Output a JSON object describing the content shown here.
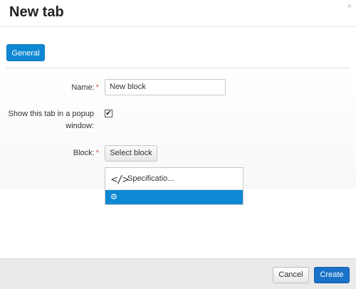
{
  "dialog": {
    "title": "New tab",
    "close_glyph": "×"
  },
  "tabs": [
    {
      "label": "General",
      "active": true
    }
  ],
  "form": {
    "name_label": "Name:",
    "required_mark": "*",
    "name_value": "New block",
    "popup_label_line1": "Show this tab in a popup",
    "popup_label_line2": "window:",
    "popup_checked": true,
    "check_glyph": "✔",
    "block_label": "Block:",
    "select_block_label": "Select block",
    "block_items": [
      {
        "icon": "code-icon",
        "glyph": "</>",
        "label": "Specificatio..."
      }
    ],
    "selected_icon": "gear-icon",
    "gear_glyph": "⚙"
  },
  "footer": {
    "cancel_label": "Cancel",
    "create_label": "Create"
  },
  "colors": {
    "accent": "#0e88d3",
    "create_button": "#1a73c9",
    "required": "#d9534f"
  }
}
